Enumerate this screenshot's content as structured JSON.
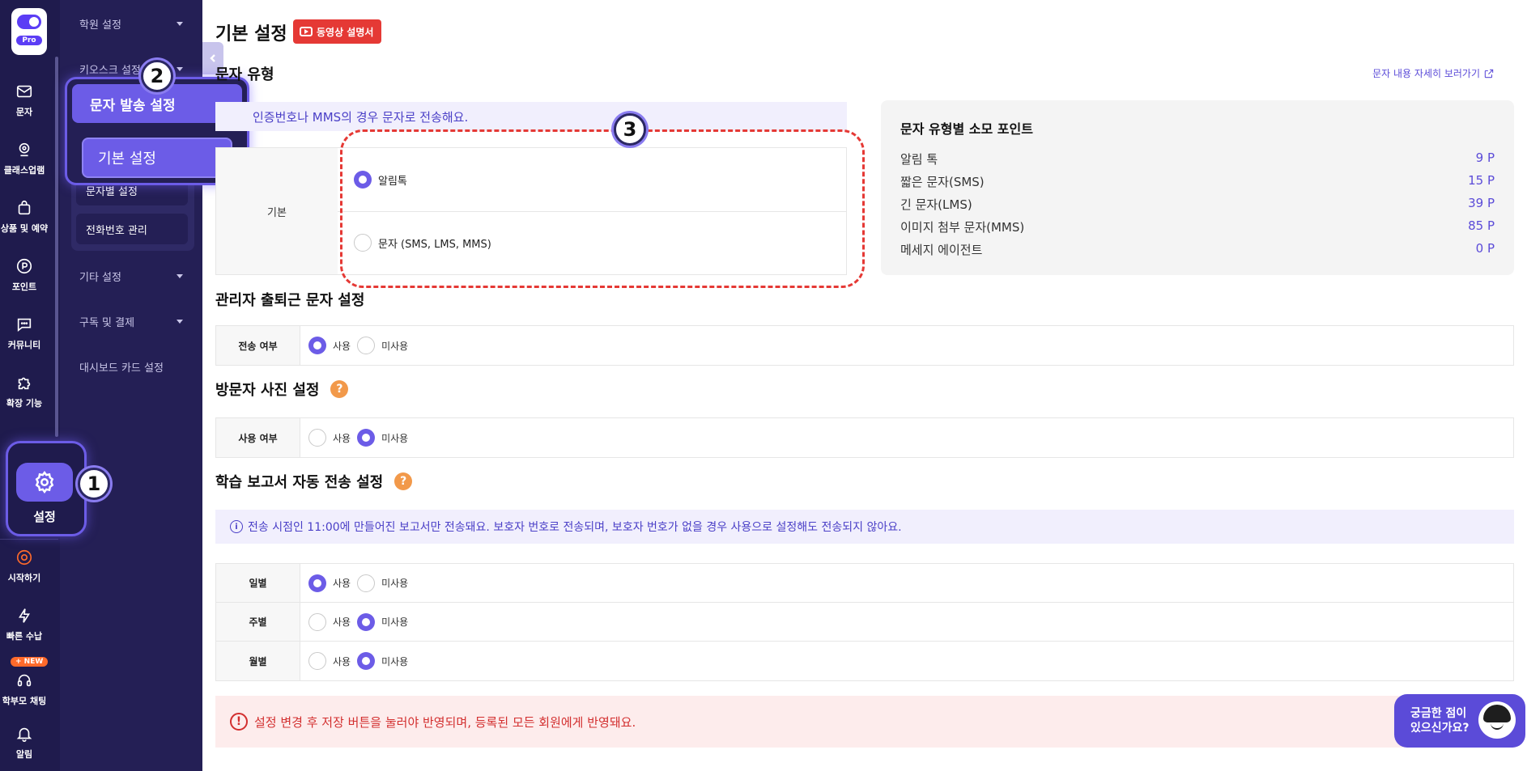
{
  "rail": {
    "logo_badge": "Pro",
    "items": [
      {
        "label": "문자",
        "icon": "mail-icon"
      },
      {
        "label": "클래스업램",
        "icon": "webcam-icon"
      },
      {
        "label": "상품 및 예약",
        "icon": "bag-icon"
      },
      {
        "label": "포인트",
        "icon": "point-icon"
      },
      {
        "label": "커뮤니티",
        "icon": "chat-icon"
      },
      {
        "label": "확장 기능",
        "icon": "puzzle-icon"
      },
      {
        "label": "설정",
        "icon": "gear-icon"
      },
      {
        "label": "시작하기",
        "icon": "start-icon"
      },
      {
        "label": "빠른 수납",
        "icon": "bolt-icon"
      },
      {
        "label": "학부모 채팅",
        "icon": "headset-icon"
      },
      {
        "label": "알림",
        "icon": "bell-icon"
      }
    ],
    "new_badge": "+ NEW"
  },
  "subnav": {
    "items": [
      {
        "label": "학원 설정"
      },
      {
        "label": "키오스크 설정"
      },
      {
        "label": "기타 설정"
      },
      {
        "label": "구독 및 결제"
      },
      {
        "label": "대시보드 카드 설정"
      }
    ],
    "sms_group": {
      "label": "문자 발송 설정",
      "children": [
        "기본 설정",
        "문자별 설정",
        "전화번호 관리"
      ]
    }
  },
  "steps": [
    "1",
    "2",
    "3"
  ],
  "page": {
    "title": "기본 설정",
    "video_button": "동영상 설명서"
  },
  "msg_type": {
    "section_title": "문자 유형",
    "detail_link": "문자 내용 자세히 보러가기",
    "info": "인증번호나 MMS의 경우 문자로 전송해요.",
    "row_label": "기본",
    "options": [
      "알림톡",
      "문자 (SMS, LMS, MMS)"
    ],
    "selected": 0
  },
  "points": {
    "title": "문자 유형별 소모 포인트",
    "rows": [
      {
        "name": "알림 톡",
        "value": "9 P"
      },
      {
        "name": "짧은 문자(SMS)",
        "value": "15 P"
      },
      {
        "name": "긴 문자(LMS)",
        "value": "39 P"
      },
      {
        "name": "이미지 첨부 문자(MMS)",
        "value": "85 P"
      },
      {
        "name": "메세지 에이전트",
        "value": "0 P"
      }
    ]
  },
  "admin_attendance": {
    "section_title": "관리자 출퇴근 문자 설정",
    "rows": [
      {
        "label": "전송 여부",
        "use": "사용",
        "nouse": "미사용",
        "selected": "use"
      }
    ]
  },
  "visitor_photo": {
    "section_title": "방문자 사진 설정",
    "help": "?",
    "rows": [
      {
        "label": "사용 여부",
        "use": "사용",
        "nouse": "미사용",
        "selected": "nouse"
      }
    ]
  },
  "report": {
    "section_title": "학습 보고서 자동 전송 설정",
    "help": "?",
    "info_icon": "i",
    "info": "전송 시점인 11:00에 만들어진 보고서만 전송돼요. 보호자 번호로 전송되며, 보호자 번호가 없을 경우 사용으로 설정해도 전송되지 않아요.",
    "rows": [
      {
        "label": "일별",
        "use": "사용",
        "nouse": "미사용",
        "selected": "use"
      },
      {
        "label": "주별",
        "use": "사용",
        "nouse": "미사용",
        "selected": "nouse"
      },
      {
        "label": "월별",
        "use": "사용",
        "nouse": "미사용",
        "selected": "nouse"
      }
    ]
  },
  "warning": {
    "icon": "!",
    "text": "설정 변경 후 저장 버튼을 눌러야 반영되며, 등록된 모든 회원에게 반영돼요."
  },
  "help_fab": {
    "line1": "궁금한 점이",
    "line2": "있으신가요?"
  },
  "colors": {
    "rail_bg": "#1f1b4d",
    "accent": "#6c5ce7",
    "video_red": "#e53935",
    "warn_bg": "#fdecec"
  }
}
